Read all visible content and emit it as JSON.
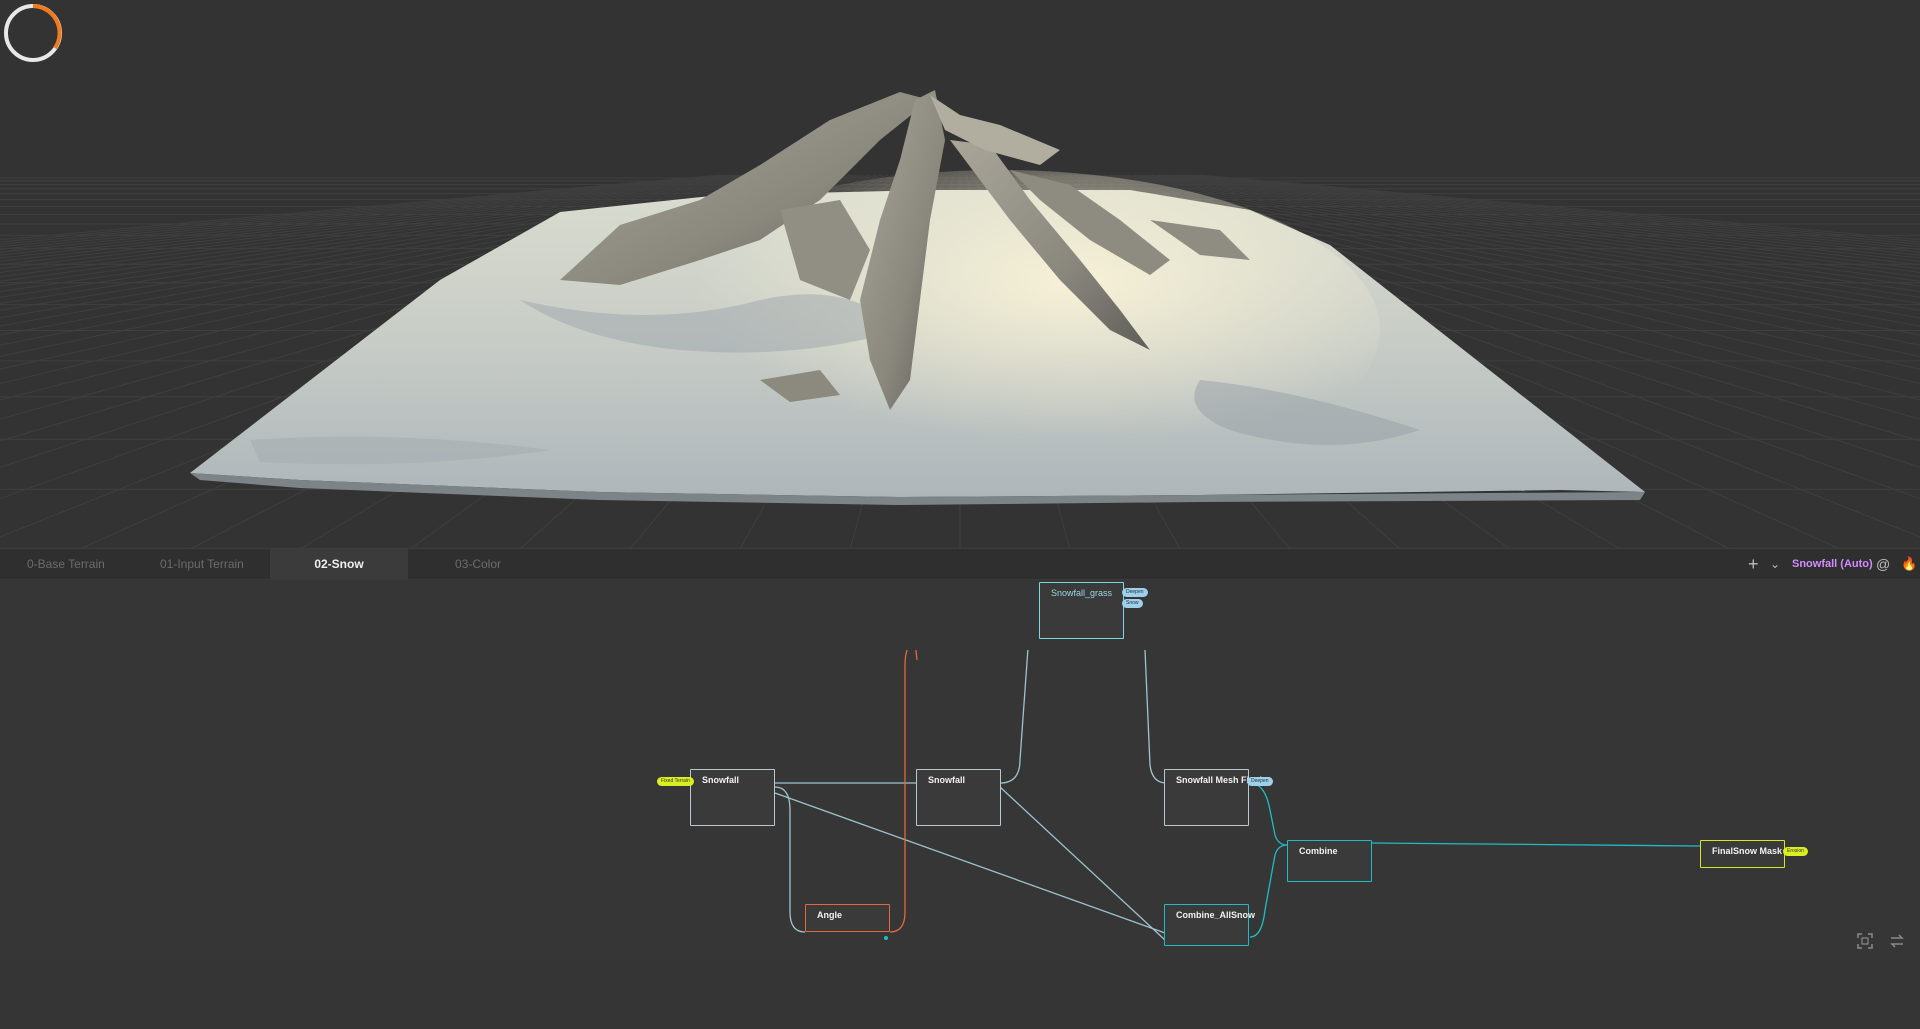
{
  "tabs": [
    {
      "label": "0-Base Terrain",
      "active": false
    },
    {
      "label": "01-Input Terrain",
      "active": false
    },
    {
      "label": "02-Snow",
      "active": true
    },
    {
      "label": "03-Color",
      "active": false
    }
  ],
  "toolbar": {
    "add_icon": "+",
    "dropdown_icon": "⌄",
    "build_label": "Snowfall (Auto)",
    "sync_icon": "@",
    "fire_icon": "🔥"
  },
  "nodes": {
    "snowfall_1": {
      "title": "Snowfall",
      "input_pill": "Fixed Terrain"
    },
    "snowfall_2": {
      "title": "Snowfall"
    },
    "snowfall_grass": {
      "title": "Snowfall_grass",
      "pill_1": "Deepen",
      "pill_2": "Snow"
    },
    "snowfall_mesh_final": {
      "title": "Snowfall Mesh Final",
      "pill": "Deepen"
    },
    "angle": {
      "title": "Angle"
    },
    "combine_allsnow": {
      "title": "Combine_AllSnow"
    },
    "combine": {
      "title": "Combine"
    },
    "finalsnow_mask": {
      "title": "FinalSnow Mask",
      "pill": "Erosion"
    }
  },
  "colors": {
    "accent_orange": "#f07a1c",
    "build_purple": "#d38cff",
    "teal": "#1fbcc4",
    "yellow": "#d8e81e",
    "orange_node": "#e06a3c"
  },
  "bottom_icons": [
    "frame-icon",
    "swap-icon"
  ]
}
